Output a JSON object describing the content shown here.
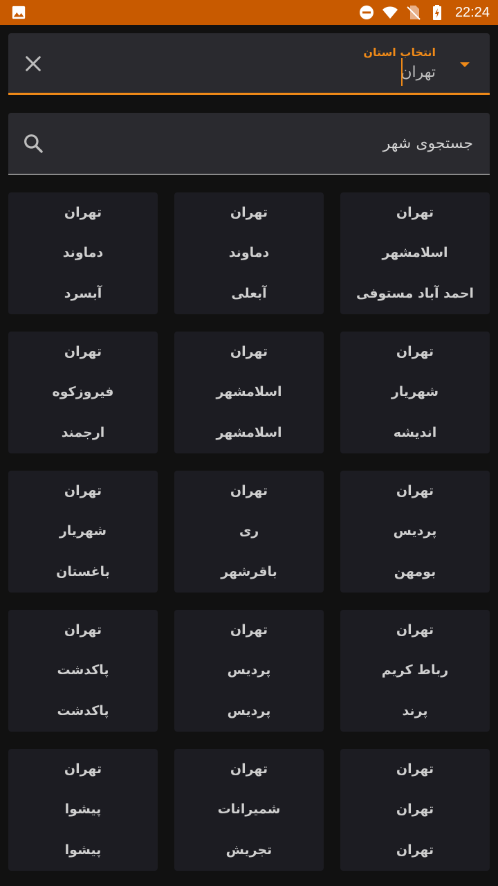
{
  "status_bar": {
    "time": "22:24",
    "icons": [
      "gallery-icon",
      "do-not-disturb-icon",
      "wifi-icon",
      "no-sim-icon",
      "battery-charging-icon"
    ]
  },
  "province": {
    "label": "انتخاب استان",
    "value": "تهران",
    "accent_color": "#f08a18"
  },
  "search": {
    "placeholder": "جستجوی شهر",
    "value": ""
  },
  "cards": [
    {
      "province": "تهران",
      "county": "اسلامشهر",
      "city": "احمد آباد مستوفی"
    },
    {
      "province": "تهران",
      "county": "دماوند",
      "city": "آبعلی"
    },
    {
      "province": "تهران",
      "county": "دماوند",
      "city": "آبسرد"
    },
    {
      "province": "تهران",
      "county": "شهریار",
      "city": "اندیشه"
    },
    {
      "province": "تهران",
      "county": "اسلامشهر",
      "city": "اسلامشهر"
    },
    {
      "province": "تهران",
      "county": "فیروزکوه",
      "city": "ارجمند"
    },
    {
      "province": "تهران",
      "county": "پردیس",
      "city": "بومهن"
    },
    {
      "province": "تهران",
      "county": "ری",
      "city": "باقرشهر"
    },
    {
      "province": "تهران",
      "county": "شهریار",
      "city": "باغستان"
    },
    {
      "province": "تهران",
      "county": "رباط کریم",
      "city": "پرند"
    },
    {
      "province": "تهران",
      "county": "پردیس",
      "city": "پردیس"
    },
    {
      "province": "تهران",
      "county": "پاکدشت",
      "city": "پاکدشت"
    },
    {
      "province": "تهران",
      "county": "تهران",
      "city": "تهران"
    },
    {
      "province": "تهران",
      "county": "شمیرانات",
      "city": "تجریش"
    },
    {
      "province": "تهران",
      "county": "پیشوا",
      "city": "پیشوا"
    }
  ]
}
